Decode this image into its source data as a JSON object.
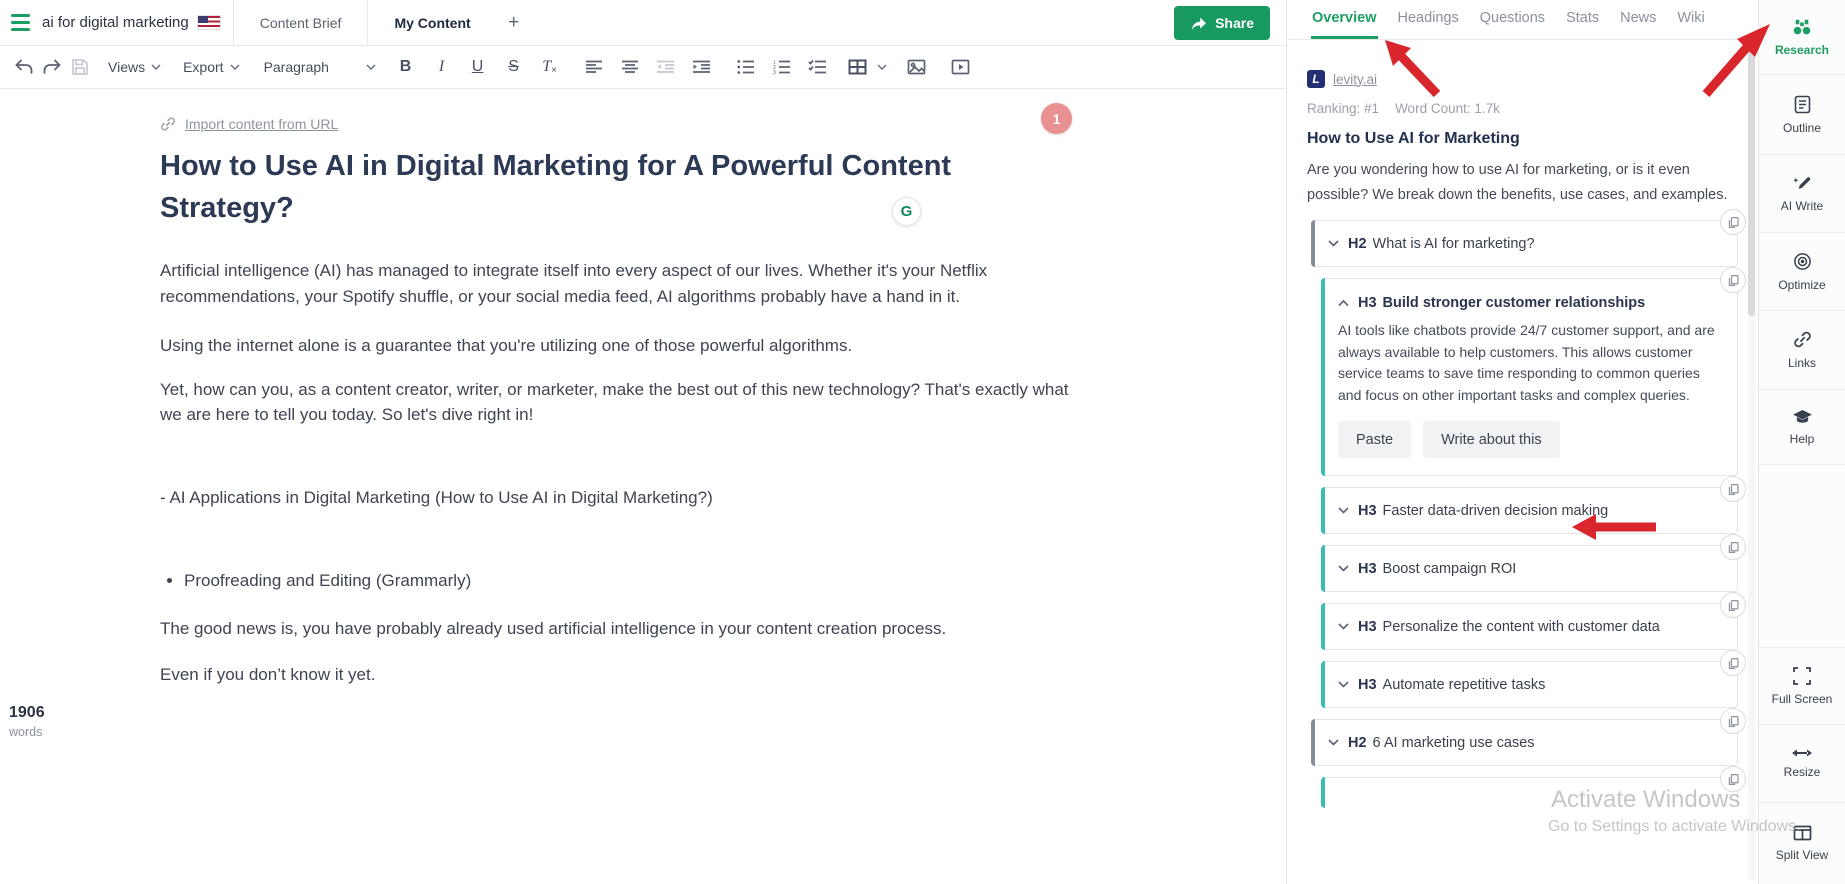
{
  "topbar": {
    "doc_title": "ai for digital marketing",
    "tabs": [
      "Content Brief",
      "My Content"
    ],
    "new_tab": "+",
    "share": "Share"
  },
  "toolbar": {
    "views": "Views",
    "export": "Export",
    "paragraph": "Paragraph",
    "bold": "B",
    "italic": "I",
    "underline": "U",
    "strike": "S"
  },
  "editor": {
    "import_link": "Import content from URL",
    "comment_badge": "1",
    "grammarly_letter": "G",
    "title": "How to Use AI in Digital Marketing for A Powerful Content Strategy?",
    "paragraphs": [
      "Artificial intelligence (AI) has managed to integrate itself into every aspect of our lives. Whether it's your Netflix recommendations, your Spotify shuffle, or your social media feed, AI algorithms probably have a hand in it.",
      "Using the internet alone is a guarantee that you're utilizing one of those powerful algorithms.",
      "Yet, how can you, as a content creator, writer, or marketer, make the best out of this new technology? That's exactly what we are here to tell you today. So let's dive right in!"
    ],
    "dash_line": "- AI Applications in Digital Marketing (How to Use AI in Digital Marketing?)",
    "bullet_item": "Proofreading and Editing (Grammarly)",
    "closing": [
      "The good news is, you have probably already used artificial intelligence in your content creation process.",
      "Even if you don’t know it yet."
    ],
    "word_count": "1906",
    "words_label": "words"
  },
  "panel": {
    "tabs": [
      "Overview",
      "Headings",
      "Questions",
      "Stats",
      "News",
      "Wiki"
    ],
    "result": {
      "favicon_letter": "L",
      "domain": "levity.ai",
      "ranking": "Ranking: #1",
      "word_count": "Word Count: 1.7k",
      "title": "How to Use AI for Marketing",
      "description": "Are you wondering how to use AI for marketing, or is it even possible? We break down the benefits, use cases, and examples."
    },
    "cards": [
      {
        "level": "H2",
        "title": "What is AI for marketing?"
      },
      {
        "level": "H3",
        "title": "Build stronger customer relationships",
        "body": "AI tools like chatbots provide 24/7 customer support, and are always available to help customers. This allows customer service teams to save time responding to common queries and focus on other important tasks and complex queries.",
        "paste": "Paste",
        "write": "Write about this"
      },
      {
        "level": "H3",
        "title": "Faster data-driven decision making"
      },
      {
        "level": "H3",
        "title": "Boost campaign ROI"
      },
      {
        "level": "H3",
        "title": "Personalize the content with customer data"
      },
      {
        "level": "H3",
        "title": "Automate repetitive tasks"
      },
      {
        "level": "H2",
        "title": "6 AI marketing use cases"
      }
    ]
  },
  "sidebar": {
    "items": [
      {
        "label": "Research",
        "active": true
      },
      {
        "label": "Outline"
      },
      {
        "label": "AI Write"
      },
      {
        "label": "Optimize"
      },
      {
        "label": "Links"
      },
      {
        "label": "Help"
      }
    ],
    "tools": [
      {
        "label": "Full Screen"
      },
      {
        "label": "Resize"
      },
      {
        "label": "Split View"
      }
    ]
  },
  "watermark": {
    "line1": "Activate Windows",
    "line2": "Go to Settings to activate Windows."
  },
  "colors": {
    "accent_green": "#18995f",
    "teal_accent": "#36bdb4",
    "gray_accent": "#878e99",
    "arrow_red": "#d9252c",
    "badge_pink": "#e99090"
  }
}
